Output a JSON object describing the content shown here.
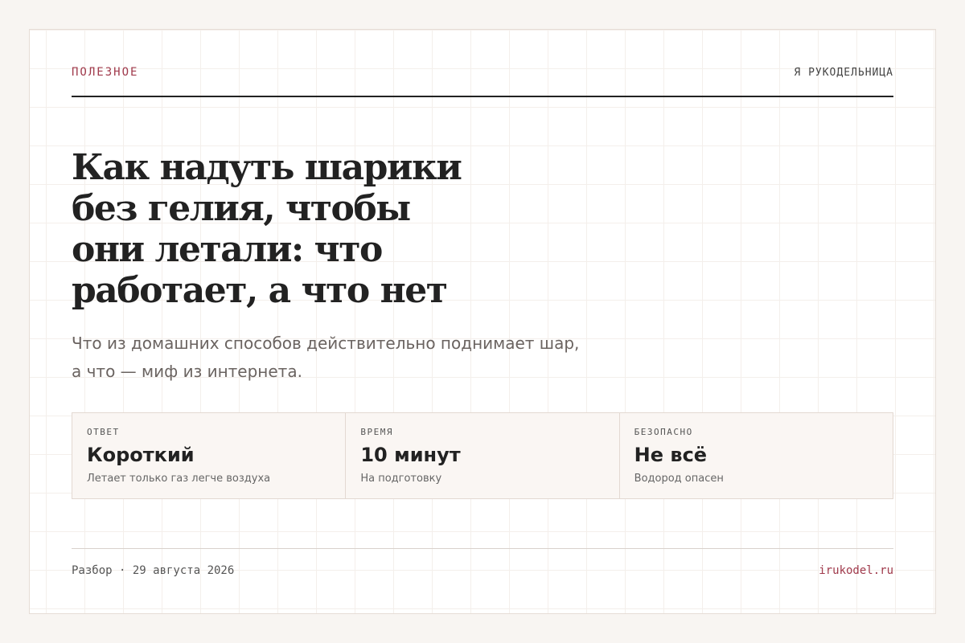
{
  "header": {
    "section": "ПОЛЕЗНОЕ",
    "brand": "Я РУКОДЕЛЬНИЦА"
  },
  "article": {
    "title": "Как надуть шарики без гелия, чтобы они летали: что работает, а что нет",
    "subtitle": "Что из домашних способов действительно поднимает шар, а что — миф из интернета."
  },
  "stats": [
    {
      "label": "ОТВЕТ",
      "value": "Короткий",
      "note": "Летает только газ легче воздуха"
    },
    {
      "label": "ВРЕМЯ",
      "value": "10 минут",
      "note": "На подготовку"
    },
    {
      "label": "БЕЗОПАСНО",
      "value": "Не всё",
      "note": "Водород опасен"
    }
  ],
  "footer": {
    "meta": "Разбор · 29 августа 2026",
    "site": "irukodel.ru"
  },
  "colors": {
    "accent": "#a03a4c",
    "text": "#222222",
    "background": "#f8f5f2"
  }
}
